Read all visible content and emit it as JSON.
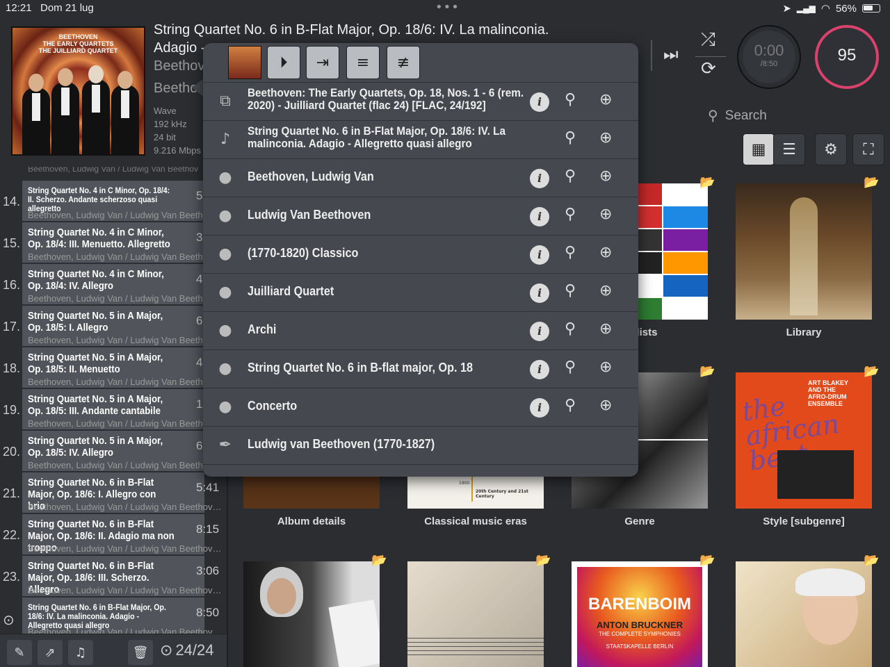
{
  "status": {
    "time": "12:21",
    "date": "Dom 21 lug",
    "battery": "56%"
  },
  "now_playing": {
    "title": "String Quartet No. 6 in B-Flat Major, Op. 18/6: IV. La malinconia. Adagio - Allegretto quasi allegro",
    "title_line1": "String Quartet No. 6 in B-Flat Major, Op. 18/6: IV. La malinconia.",
    "title_line2": "Adagio - ",
    "artist1": "Beethov",
    "artist2": "Beethove",
    "format": "Wave",
    "samplerate": "192 kHz",
    "bitdepth": "24 bit",
    "bitrate": "9.216 Mbps",
    "cover_text": "BEETHOVEN\nTHE EARLY QUARTETS\nTHE JUILLIARD QUARTET",
    "timer_elapsed": "0:00",
    "timer_total": "/8:50",
    "volume": "95"
  },
  "search": {
    "placeholder": "Search"
  },
  "queue_top": "Beethoven, Ludwig Van / Ludwig Van Beethov",
  "queue": [
    {
      "num": "14.",
      "title": "String Quartet No. 4 in C Minor, Op. 18/4: II. Scherzo. Andante scherzoso quasi allegretto",
      "dur": "5",
      "artist": "Beethoven, Ludwig Van / Ludwig Van Beetho",
      "small": true
    },
    {
      "num": "15.",
      "title": "String Quartet No. 4 in C Minor, Op. 18/4: III. Menuetto. Allegretto",
      "dur": "3",
      "artist": "Beethoven, Ludwig Van / Ludwig Van Beetho",
      "small": false
    },
    {
      "num": "16.",
      "title": "String Quartet No. 4 in C Minor, Op. 18/4: IV. Allegro",
      "dur": "4",
      "artist": "Beethoven, Ludwig Van / Ludwig Van Beetho",
      "small": false
    },
    {
      "num": "17.",
      "title": "String Quartet No. 5 in A Major, Op. 18/5: I. Allegro",
      "dur": "6",
      "artist": "Beethoven, Ludwig Van / Ludwig Van Beetho",
      "small": false
    },
    {
      "num": "18.",
      "title": "String Quartet No. 5 in A Major, Op. 18/5: II. Menuetto",
      "dur": "4",
      "artist": "Beethoven, Ludwig Van / Ludwig Van Beetho",
      "small": false
    },
    {
      "num": "19.",
      "title": "String Quartet No. 5 in A Major, Op. 18/5: III. Andante cantabile",
      "dur": "10",
      "artist": "Beethoven, Ludwig Van / Ludwig Van Beetho",
      "small": false
    },
    {
      "num": "20.",
      "title": "String Quartet No. 5 in A Major, Op. 18/5: IV. Allegro",
      "dur": "6",
      "artist": "Beethoven, Ludwig Van / Ludwig Van Beetho",
      "small": false
    },
    {
      "num": "21.",
      "title": "String Quartet No. 6 in B-Flat Major, Op. 18/6: I. Allegro con brio",
      "dur": "5:41",
      "artist": "Beethoven, Ludwig Van / Ludwig Van Beethove…",
      "small": false
    },
    {
      "num": "22.",
      "title": "String Quartet No. 6 in B-Flat Major, Op. 18/6: II. Adagio ma non troppo",
      "dur": "8:15",
      "artist": "Beethoven, Ludwig Van / Ludwig Van Beethove…",
      "small": false
    },
    {
      "num": "23.",
      "title": "String Quartet No. 6 in B-Flat Major, Op. 18/6: III. Scherzo. Allegro",
      "dur": "3:06",
      "artist": "Beethoven, Ludwig Van / Ludwig Van Beethove…",
      "small": false
    },
    {
      "num": "",
      "title": "String Quartet No. 6 in B-Flat Major, Op. 18/6: IV. La malinconia. Adagio - Allegretto quasi allegro",
      "dur": "8:50",
      "artist": "Beethoven, Ludwig Van / Ludwig Van Beethove…",
      "small": true
    }
  ],
  "queue_count": "24/24",
  "tiles": [
    {
      "label": "laylists"
    },
    {
      "label": "Library"
    },
    {
      "label": "Album details"
    },
    {
      "label": "Classical music eras"
    },
    {
      "label": "Genre"
    },
    {
      "label": "Style [subgenre]"
    }
  ],
  "tile_texts": {
    "art_blakey": "ART BLAKEY\nAND THE\nAFRO-DRUM\nENSEMBLE",
    "african_beat": "the african beat",
    "barenboim": "BARENBOIM",
    "bruckner": "ANTON BRUCKNER",
    "symphonies": "THE COMPLETE SYMPHONIES",
    "staatskapelle": "STAATSKAPELLE BERLIN",
    "eras": "20th Century and 21st Century",
    "eras_year": "1900"
  },
  "popup": {
    "rows": [
      {
        "icon": "album",
        "text": "Beethoven: The Early Quartets, Op. 18,  Nos. 1 - 6 (rem. 2020) - Juilliard Quartet (flac 24) [FLAC, 24/192]",
        "two": true,
        "info": true
      },
      {
        "icon": "note",
        "text": "String Quartet No. 6 in B-Flat Major, Op. 18/6: IV. La malinconia. Adagio - Allegretto quasi allegro",
        "two": true,
        "info": false
      },
      {
        "icon": "person",
        "text": "Beethoven, Ludwig Van",
        "two": false,
        "info": true
      },
      {
        "icon": "person",
        "text": "Ludwig Van Beethoven",
        "two": false,
        "info": true
      },
      {
        "icon": "person",
        "text": "(1770-1820) Classico",
        "two": false,
        "info": true
      },
      {
        "icon": "person",
        "text": "Juilliard Quartet",
        "two": false,
        "info": true
      },
      {
        "icon": "person",
        "text": "Archi",
        "two": false,
        "info": true
      },
      {
        "icon": "person",
        "text": "String Quartet No.  6 in B-flat major, Op. 18",
        "two": false,
        "info": true
      },
      {
        "icon": "person",
        "text": "Concerto",
        "two": false,
        "info": true
      },
      {
        "icon": "pen",
        "text": "Ludwig van Beethoven (1770-1827)",
        "two": false,
        "info": false
      }
    ]
  },
  "colors": {
    "accent_volume": "#d9426d",
    "queue_row_bg": "#51545a",
    "popup_bg": "#45484e"
  }
}
